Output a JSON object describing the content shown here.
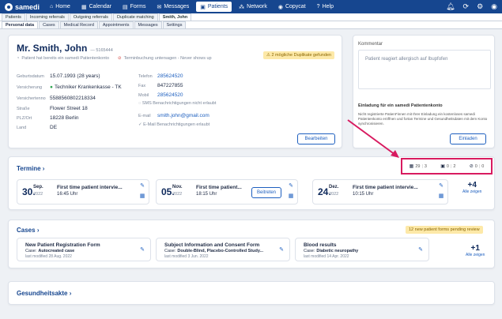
{
  "topbar": {
    "brand": "samedi",
    "nav": [
      {
        "label": "Home",
        "icon": "home-icon",
        "glyph": "⌂"
      },
      {
        "label": "Calendar",
        "icon": "calendar-icon",
        "glyph": "▦"
      },
      {
        "label": "Forms",
        "icon": "forms-icon",
        "glyph": "▤"
      },
      {
        "label": "Messages",
        "icon": "messages-icon",
        "glyph": "✉"
      },
      {
        "label": "Patients",
        "icon": "patients-icon",
        "glyph": "▣"
      },
      {
        "label": "Network",
        "icon": "network-icon",
        "glyph": "⁂"
      },
      {
        "label": "Copycat",
        "icon": "copycat-icon",
        "glyph": "◉"
      },
      {
        "label": "Help",
        "icon": "help-icon",
        "glyph": "?"
      }
    ],
    "right_icons": [
      "bell-icon",
      "sync-icon",
      "settings-icon",
      "user-icon"
    ]
  },
  "tabs1": [
    "Patients",
    "Incoming referrals",
    "Outgoing referrals",
    "Duplicate matching",
    "Smith, John"
  ],
  "tabs2": [
    "Personal data",
    "Cases",
    "Medical Record",
    "Appointments",
    "Messages",
    "Settings"
  ],
  "patient": {
    "name": "Mr. Smith, John",
    "pid": "— 5165444",
    "status1": "Patient hat bereits ein samedi Patientenkonto",
    "status2": "Terminbuchung untersagen - Never shows up",
    "duplicates": "2 mögliche Duplikate gefunden",
    "fields_left": [
      {
        "label": "Geburtsdatum",
        "value": "15.07.1993 (28 years)"
      },
      {
        "label": "Versicherung",
        "value": "Techniker Krankenkasse - TK"
      },
      {
        "label": "Versichertenno",
        "value": "5588560802218334"
      },
      {
        "label": "Straße",
        "value": "Flower Street 18"
      },
      {
        "label": "PLZ/Ort",
        "value": "18228 Berlin"
      },
      {
        "label": "Land",
        "value": "DE"
      }
    ],
    "fields_right": [
      {
        "label": "Telefon",
        "value": "285624520"
      },
      {
        "label": "Fax",
        "value": "847227855"
      },
      {
        "label": "Mobil",
        "value": "285624520"
      },
      {
        "label": "E-mail",
        "value": "smith.john@gmail.com"
      }
    ],
    "sms_note": "SMS Benachrichtigungen nicht erlaubt",
    "email_note": "E-Mail Benachrichtigungen erlaubt",
    "edit_button": "Bearbeiten"
  },
  "comment": {
    "title": "Kommentar",
    "text": "Patient reagiert allergisch auf Ibupfofen"
  },
  "invite": {
    "title": "Einladung für ein samedi Patientenkonto",
    "text": "Nicht registrierte Patient*innen mit Ihrer Einladung ein kostenloses samedi Patientenkonto eröffnen und fortan Termine und Gesundheitsdaten mit dem Konto synchronisieren.",
    "button": "Einladen"
  },
  "termine": {
    "title": "Termine",
    "counters": [
      {
        "icon": "calendar-icon",
        "a": "29",
        "b": "3"
      },
      {
        "icon": "calendar-check-icon",
        "a": "0",
        "b": "2"
      },
      {
        "icon": "person-off-icon",
        "a": "0",
        "b": "0"
      }
    ],
    "appointments": [
      {
        "day": "30.",
        "month": "Sep.",
        "year": "2022",
        "title": "First time patient intervie...",
        "time": "16:45 Uhr"
      },
      {
        "day": "05.",
        "month": "Nov.",
        "year": "2022",
        "title": "First time patient...",
        "time": "18:15 Uhr",
        "action": "Beitreten"
      },
      {
        "day": "24.",
        "month": "Dez.",
        "year": "2022",
        "title": "First time patient intervie...",
        "time": "10:15 Uhr"
      }
    ],
    "more_count": "+4",
    "more_label": "Alle zeigen"
  },
  "cases": {
    "title": "Cases",
    "badge": "12 new patient forms pending review",
    "items": [
      {
        "title": "New Patient Registration Form",
        "case_label": "Case:",
        "case": "Autocreated case",
        "modified": "last modified 28 Aug. 2022"
      },
      {
        "title": "Subject Information and Consent Form",
        "case_label": "Case:",
        "case": "Double-Blind, Placebo-Controlled Study...",
        "modified": "last modified 3 Jun. 2022"
      },
      {
        "title": "Blood results",
        "case_label": "Case:",
        "case": "Diabetic neuropathy",
        "modified": "last modified 14 Apr. 2022"
      }
    ],
    "more_count": "+1",
    "more_label": "Alle zeigen"
  },
  "health": {
    "title": "Gesundheitsakte"
  },
  "colors": {
    "brand": "#16468f",
    "highlight": "#d81b60",
    "warn": "#fde9a8"
  }
}
